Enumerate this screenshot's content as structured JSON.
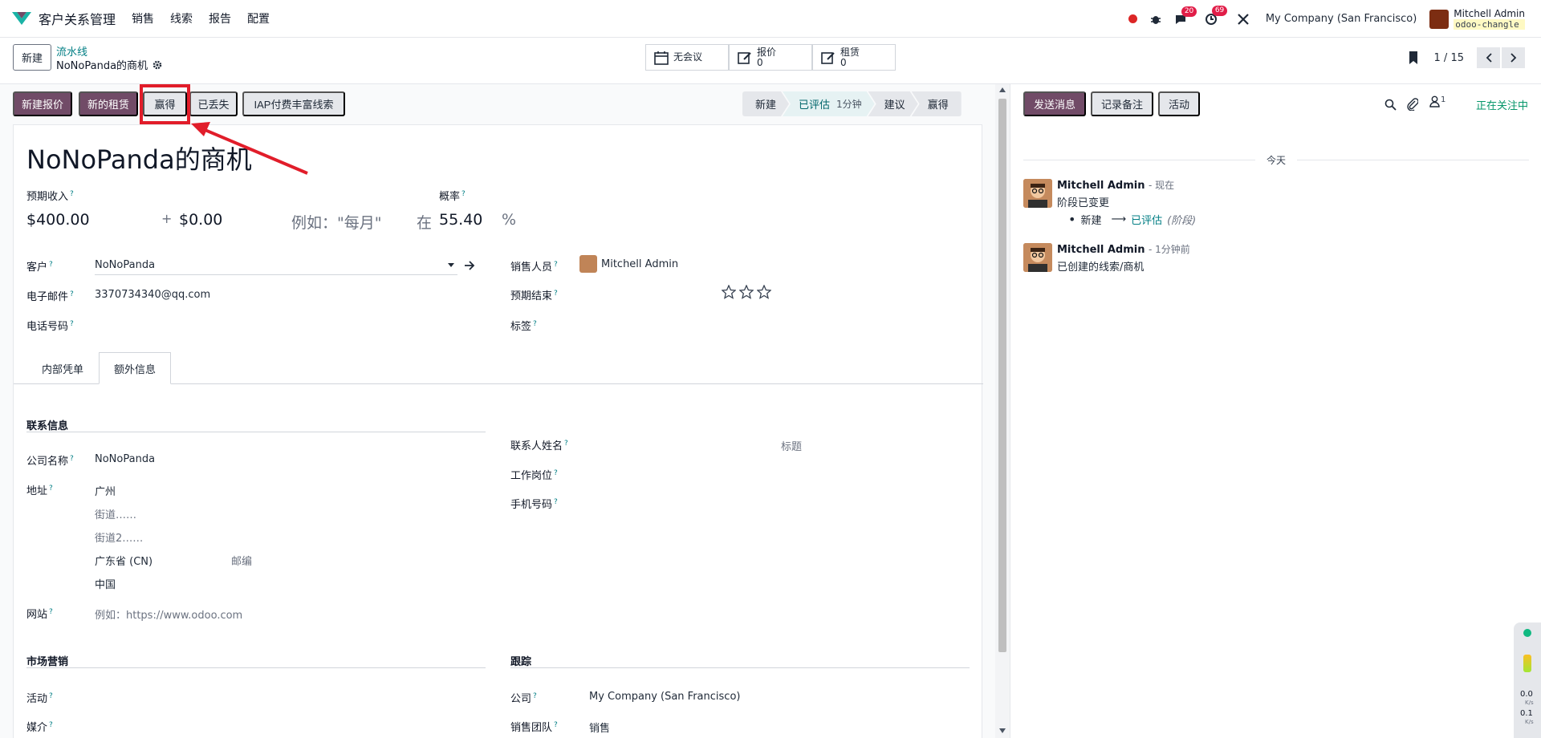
{
  "topbar": {
    "app_title": "客户关系管理",
    "menu": [
      "销售",
      "线索",
      "报告",
      "配置"
    ],
    "messages_count": "20",
    "activities_count": "69",
    "company": "My Company (San Francisco)",
    "user_name": "Mitchell Admin",
    "db_name": "odoo-changle"
  },
  "control": {
    "new_label": "新建",
    "breadcrumb_parent": "流水线",
    "breadcrumb_current": "NoNoPanda的商机",
    "smart_buttons": [
      {
        "label": "无会议",
        "count": ""
      },
      {
        "label": "报价",
        "count": "0"
      },
      {
        "label": "租赁",
        "count": "0"
      }
    ],
    "pager": "1 / 15"
  },
  "actions": {
    "new_quotation": "新建报价",
    "new_rental": "新的租赁",
    "won": "赢得",
    "lost": "已丢失",
    "iap": "IAP付费丰富线索"
  },
  "stages": [
    {
      "label": "新建",
      "sub": ""
    },
    {
      "label": "已评估",
      "sub": "1分钟"
    },
    {
      "label": "建议",
      "sub": ""
    },
    {
      "label": "赢得",
      "sub": ""
    }
  ],
  "form": {
    "title": "NoNoPanda的商机",
    "expected_revenue_label": "预期收入",
    "probability_label": "概率",
    "revenue": "$400.00",
    "plus": "+",
    "recurring": "$0.00",
    "recurring_placeholder": "例如：\"每月\"",
    "at": "在",
    "probability": "55.40",
    "percent": "%",
    "customer_label": "客户",
    "customer": "NoNoPanda",
    "email_label": "电子邮件",
    "email": "3370734340@qq.com",
    "phone_label": "电话号码",
    "salesperson_label": "销售人员",
    "salesperson": "Mitchell Admin",
    "expected_closing_label": "预期结束",
    "tags_label": "标签",
    "priority_stars": 0,
    "tabs": [
      "内部凭单",
      "额外信息"
    ],
    "contact_info_header": "联系信息",
    "company_name_label": "公司名称",
    "company_name": "NoNoPanda",
    "address_label": "地址",
    "city": "广州",
    "street": "街道……",
    "street2": "街道2……",
    "state": "广东省 (CN)",
    "zip_placeholder": "邮编",
    "country": "中国",
    "website_label": "网站",
    "website_placeholder": "例如：https://www.odoo.com",
    "contact_name_label": "联系人姓名",
    "title_placeholder": "标题",
    "job_position_label": "工作岗位",
    "mobile_label": "手机号码",
    "marketing_header": "市场营销",
    "tracking_header": "跟踪",
    "campaign_label": "活动",
    "medium_label": "媒介",
    "company_label": "公司",
    "company_value": "My Company (San Francisco)",
    "sales_team_label": "销售团队",
    "sales_team": "销售"
  },
  "chatter": {
    "send_message": "发送消息",
    "log_note": "记录备注",
    "activity": "活动",
    "followers_count": "1",
    "following": "正在关注中",
    "day": "今天",
    "messages": [
      {
        "author": "Mitchell Admin",
        "time": "- 现在",
        "body": "阶段已变更",
        "from": "新建",
        "arrow": "⟶",
        "to": "已评估",
        "field": "(阶段)"
      },
      {
        "author": "Mitchell Admin",
        "time": "- 1分钟前",
        "body": "已创建的线索/商机"
      }
    ]
  },
  "widget": {
    "up": "0.0",
    "down": "0.1",
    "unit": "K/s"
  },
  "colors": {
    "primary": "#714b67",
    "accent": "#017e84",
    "highlight": "#e11d2a",
    "following": "#059669"
  }
}
